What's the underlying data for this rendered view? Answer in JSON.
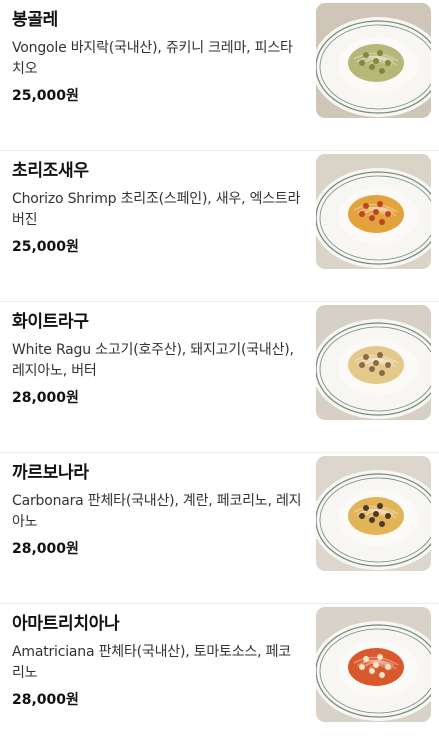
{
  "menu": {
    "items": [
      {
        "name": "봉골레",
        "description": "Vongole 바지락(국내산), 쥬키니 크레마, 피스타치오",
        "price": "25,000원",
        "image": "vongole-pasta-photo",
        "sauce": "#b7b77a",
        "topping": "#7c8a3a",
        "bg": "#cfc6b8"
      },
      {
        "name": "초리조새우",
        "description": "Chorizo Shrimp 초리조(스페인), 새우, 엑스트라버진",
        "price": "25,000원",
        "image": "chorizo-shrimp-pasta-photo",
        "sauce": "#e2a23c",
        "topping": "#c4402a",
        "bg": "#d9d3c8"
      },
      {
        "name": "화이트라구",
        "description": "White Ragu 소고기(호주산), 돼지고기(국내산), 레지아노, 버터",
        "price": "28,000원",
        "image": "white-ragu-pasta-photo",
        "sauce": "#e3c98a",
        "topping": "#8a6a4a",
        "bg": "#d6d0c6"
      },
      {
        "name": "까르보나라",
        "description": "Carbonara 판체타(국내산), 계란, 페코리노, 레지아노",
        "price": "28,000원",
        "image": "carbonara-pasta-photo",
        "sauce": "#e2b458",
        "topping": "#4a3a2a",
        "bg": "#ddd6cc"
      },
      {
        "name": "아마트리치아나",
        "description": "Amatriciana 판체타(국내산), 토마토소스, 페코리노",
        "price": "28,000원",
        "image": "amatriciana-pasta-photo",
        "sauce": "#d9582c",
        "topping": "#f2e6c8",
        "bg": "#d8d2c8"
      }
    ]
  }
}
